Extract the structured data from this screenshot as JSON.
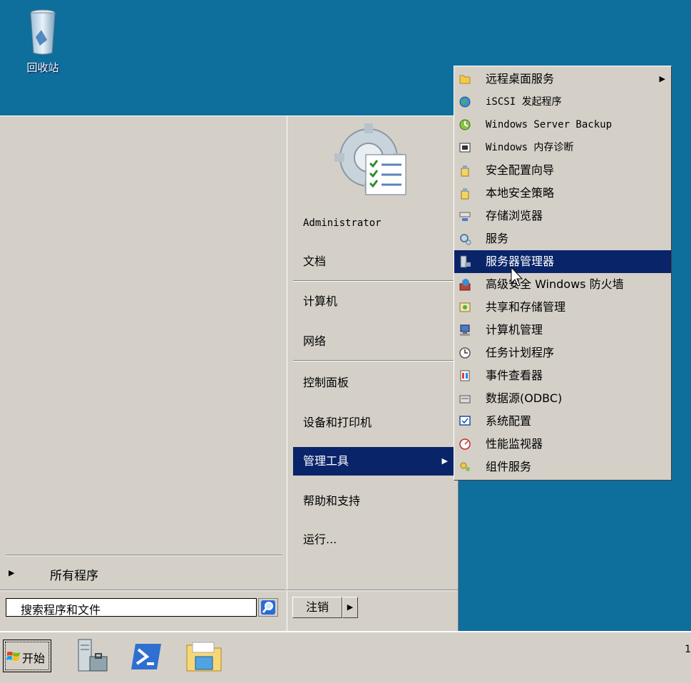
{
  "desktop": {
    "recycle_bin_label": "回收站"
  },
  "start_menu": {
    "all_programs": "所有程序",
    "search_placeholder": "搜索程序和文件",
    "right_items": [
      {
        "label": "Administrator"
      },
      {
        "label": "文档"
      },
      {
        "label": "计算机"
      },
      {
        "label": "网络"
      },
      {
        "label": "控制面板"
      },
      {
        "label": "设备和打印机"
      },
      {
        "label": "管理工具",
        "active": true
      },
      {
        "label": "帮助和支持"
      },
      {
        "label": "运行..."
      }
    ],
    "logoff_label": "注销"
  },
  "submenu": {
    "items": [
      {
        "label": "远程桌面服务",
        "icon": "folder-icon",
        "has_submenu": true
      },
      {
        "label": "iSCSI 发起程序",
        "icon": "globe-icon"
      },
      {
        "label": "Windows Server Backup",
        "icon": "backup-icon"
      },
      {
        "label": "Windows 内存诊断",
        "icon": "memory-chip-icon"
      },
      {
        "label": "安全配置向导",
        "icon": "security-wizard-icon"
      },
      {
        "label": "本地安全策略",
        "icon": "security-policy-icon"
      },
      {
        "label": "存储浏览器",
        "icon": "storage-icon"
      },
      {
        "label": "服务",
        "icon": "gears-icon"
      },
      {
        "label": "服务器管理器",
        "icon": "server-icon",
        "active": true
      },
      {
        "label": "高级安全 Windows 防火墙",
        "icon": "firewall-icon"
      },
      {
        "label": "共享和存储管理",
        "icon": "share-icon"
      },
      {
        "label": "计算机管理",
        "icon": "computer-management-icon"
      },
      {
        "label": "任务计划程序",
        "icon": "clock-icon"
      },
      {
        "label": "事件查看器",
        "icon": "event-viewer-icon"
      },
      {
        "label": "数据源(ODBC)",
        "icon": "database-icon"
      },
      {
        "label": "系统配置",
        "icon": "system-config-icon"
      },
      {
        "label": "性能监视器",
        "icon": "performance-icon"
      },
      {
        "label": "组件服务",
        "icon": "component-icon"
      }
    ]
  },
  "taskbar": {
    "start_label": "开始",
    "apps": [
      "server-manager-icon",
      "powershell-icon",
      "file-explorer-icon"
    ],
    "tray_text": "1"
  },
  "colors": {
    "desktop": "#0e6e9c",
    "highlight": "#0a246a",
    "menu_bg": "#d4d0c8"
  }
}
